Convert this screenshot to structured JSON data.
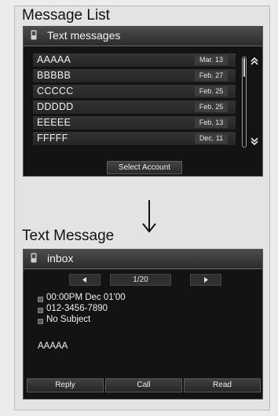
{
  "message_list": {
    "title": "Message List",
    "header": "Text messages",
    "icon": "phone-icon",
    "items": [
      {
        "name": "AAAAA",
        "date": "Mar. 13"
      },
      {
        "name": "BBBBB",
        "date": "Feb. 27"
      },
      {
        "name": "CCCCC",
        "date": "Feb. 25"
      },
      {
        "name": "DDDDD",
        "date": "Feb. 25"
      },
      {
        "name": "EEEEE",
        "date": "Feb. 13"
      },
      {
        "name": "FFFFF",
        "date": "Dec. 11"
      }
    ],
    "select_account_label": "Select Account"
  },
  "text_message": {
    "title": "Text Message",
    "header": "inbox",
    "page_counter": "1/20",
    "timestamp": "00:00PM Dec 01'00",
    "phone_number": "012-3456-7890",
    "subject": "No Subject",
    "body": "AAAAA",
    "buttons": {
      "reply": "Reply",
      "call": "Call",
      "read": "Read"
    }
  },
  "colors": {
    "screen_bg": "#131313",
    "header_bg": "#3a3a3a",
    "row_bg": "#2d2d2d",
    "text": "#f0f0f0"
  }
}
